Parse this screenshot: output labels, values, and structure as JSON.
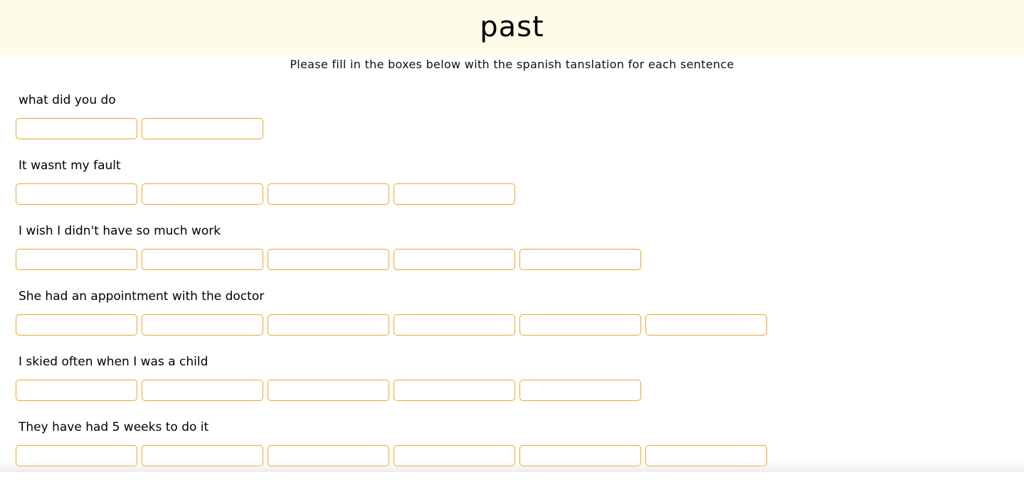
{
  "header": {
    "title": "past"
  },
  "instructions": "Please fill in the boxes below with the spanish tanslation for each sentence",
  "questions": [
    {
      "prompt": "what did you do",
      "box_count": 2
    },
    {
      "prompt": "It wasnt my fault",
      "box_count": 4
    },
    {
      "prompt": "I wish I didn't have so much work",
      "box_count": 5
    },
    {
      "prompt": "She had an appointment with the doctor",
      "box_count": 6
    },
    {
      "prompt": "I skied often when I was a child",
      "box_count": 5
    },
    {
      "prompt": "They have had 5 weeks to do it",
      "box_count": 6
    }
  ],
  "colors": {
    "header_background": "#fefbe8",
    "box_border": "#f0a32a"
  }
}
